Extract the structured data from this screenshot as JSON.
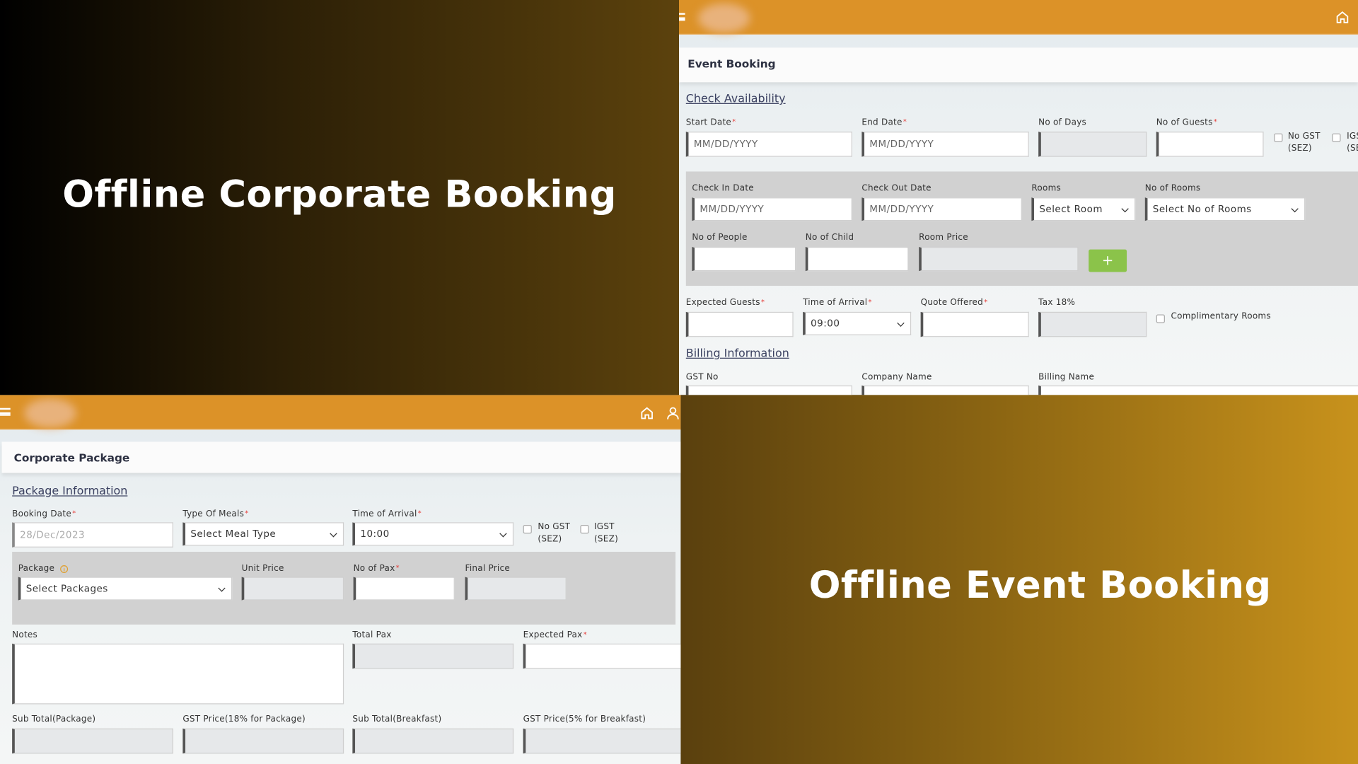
{
  "panels": {
    "corporate_title": "Offline Corporate Booking",
    "event_title": "Offline Event Booking"
  },
  "colors": {
    "header": "#dc9228",
    "add_button": "#8bc34a",
    "required": "#e53935"
  },
  "event": {
    "page_title": "Event Booking",
    "check_availability": "Check Availability",
    "start_date": {
      "label": "Start Date",
      "placeholder": "MM/DD/YYYY"
    },
    "end_date": {
      "label": "End Date",
      "placeholder": "MM/DD/YYYY"
    },
    "no_of_days": {
      "label": "No of Days"
    },
    "no_of_guests": {
      "label": "No of Guests"
    },
    "no_gst": "No GST (SEZ)",
    "igst": "IGST (SEZ)",
    "check_in": {
      "label": "Check In Date",
      "placeholder": "MM/DD/YYYY"
    },
    "check_out": {
      "label": "Check Out Date",
      "placeholder": "MM/DD/YYYY"
    },
    "rooms": {
      "label": "Rooms",
      "value": "Select Room"
    },
    "no_of_rooms": {
      "label": "No of Rooms",
      "value": "Select No of Rooms"
    },
    "no_of_people": {
      "label": "No of People"
    },
    "no_of_child": {
      "label": "No of Child"
    },
    "room_price": {
      "label": "Room Price"
    },
    "add_label": "+",
    "expected_guests": {
      "label": "Expected Guests"
    },
    "time_of_arrival": {
      "label": "Time of Arrival",
      "value": "09:00"
    },
    "quote_offered": {
      "label": "Quote Offered"
    },
    "tax": {
      "label": "Tax 18%"
    },
    "complimentary_rooms": "Complimentary Rooms",
    "billing_information": "Billing Information",
    "gst_no": {
      "label": "GST No"
    },
    "company_name": {
      "label": "Company Name"
    },
    "billing_name": {
      "label": "Billing Name"
    }
  },
  "corporate": {
    "page_title": "Corporate Package",
    "package_information": "Package Information",
    "booking_date": {
      "label": "Booking Date",
      "value": "28/Dec/2023"
    },
    "type_of_meals": {
      "label": "Type Of Meals",
      "value": "Select Meal Type"
    },
    "time_of_arrival": {
      "label": "Time of Arrival",
      "value": "10:00"
    },
    "no_gst": "No GST (SEZ)",
    "igst": "IGST (SEZ)",
    "package": {
      "label": "Package",
      "value": "Select Packages"
    },
    "unit_price": {
      "label": "Unit Price"
    },
    "no_of_pax": {
      "label": "No of Pax"
    },
    "final_price": {
      "label": "Final Price"
    },
    "notes": {
      "label": "Notes"
    },
    "total_pax": {
      "label": "Total Pax"
    },
    "expected_pax": {
      "label": "Expected Pax"
    },
    "sub_total_package": {
      "label": "Sub Total(Package)"
    },
    "gst_package": {
      "label": "GST Price(18% for Package)"
    },
    "sub_total_breakfast": {
      "label": "Sub Total(Breakfast)"
    },
    "gst_breakfast": {
      "label": "GST Price(5% for Breakfast)"
    }
  }
}
